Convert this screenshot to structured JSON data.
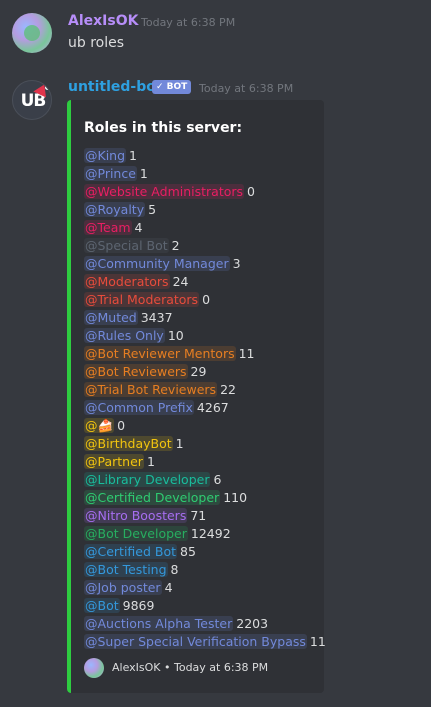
{
  "message1": {
    "username": "AlexIsOK",
    "username_color": "#b78ef9",
    "timestamp": "Today at 6:38 PM",
    "content": "ub roles"
  },
  "message2": {
    "username": "untitled-bot",
    "username_color": "#2ea0e0",
    "bot_tag": "✓ BOT",
    "timestamp": "Today at 6:38 PM",
    "embed": {
      "accent_color": "#2ecc40",
      "title": "Roles in this server:",
      "roles": [
        {
          "name": "@King",
          "count": "1",
          "color": "#7289da"
        },
        {
          "name": "@Prince",
          "count": "1",
          "color": "#7289da"
        },
        {
          "name": "@Website Administrators",
          "count": "0",
          "color": "#e91e63"
        },
        {
          "name": "@Royalty",
          "count": "5",
          "color": "#7289da"
        },
        {
          "name": "@Team",
          "count": "4",
          "color": "#e91e63"
        },
        {
          "name": "@Special Bot",
          "count": "2",
          "color": "#5d6571"
        },
        {
          "name": "@Community Manager",
          "count": "3",
          "color": "#7289da"
        },
        {
          "name": "@Moderators",
          "count": "24",
          "color": "#e74c3c"
        },
        {
          "name": "@Trial Moderators",
          "count": "0",
          "color": "#e74c3c"
        },
        {
          "name": "@Muted",
          "count": "3437",
          "color": "#7289da"
        },
        {
          "name": "@Rules Only",
          "count": "10",
          "color": "#7289da"
        },
        {
          "name": "@Bot Reviewer Mentors",
          "count": "11",
          "color": "#e67e22"
        },
        {
          "name": "@Bot Reviewers",
          "count": "29",
          "color": "#e67e22"
        },
        {
          "name": "@Trial Bot Reviewers",
          "count": "22",
          "color": "#e67e22"
        },
        {
          "name": "@Common Prefix",
          "count": "4267",
          "color": "#7289da"
        },
        {
          "name": "@🍰",
          "count": "0",
          "color": "#f1c40f"
        },
        {
          "name": "@BirthdayBot",
          "count": "1",
          "color": "#f1c40f"
        },
        {
          "name": "@Partner",
          "count": "1",
          "color": "#f1c40f"
        },
        {
          "name": "@Library Developer",
          "count": "6",
          "color": "#1abc9c"
        },
        {
          "name": "@Certified Developer",
          "count": "110",
          "color": "#2ecc71"
        },
        {
          "name": "@Nitro Boosters",
          "count": "71",
          "color": "#a66ef0"
        },
        {
          "name": "@Bot Developer",
          "count": "12492",
          "color": "#27ae60"
        },
        {
          "name": "@Certified Bot",
          "count": "85",
          "color": "#3498db"
        },
        {
          "name": "@Bot Testing",
          "count": "8",
          "color": "#3498db"
        },
        {
          "name": "@Job poster",
          "count": "4",
          "color": "#7289da"
        },
        {
          "name": "@Bot",
          "count": "9869",
          "color": "#3498db"
        },
        {
          "name": "@Auctions Alpha Tester",
          "count": "2203",
          "color": "#7289da"
        },
        {
          "name": "@Super Special Verification Bypass",
          "count": "11",
          "color": "#7289da"
        }
      ],
      "footer": "AlexIsOK • Today at 6:38 PM"
    }
  }
}
